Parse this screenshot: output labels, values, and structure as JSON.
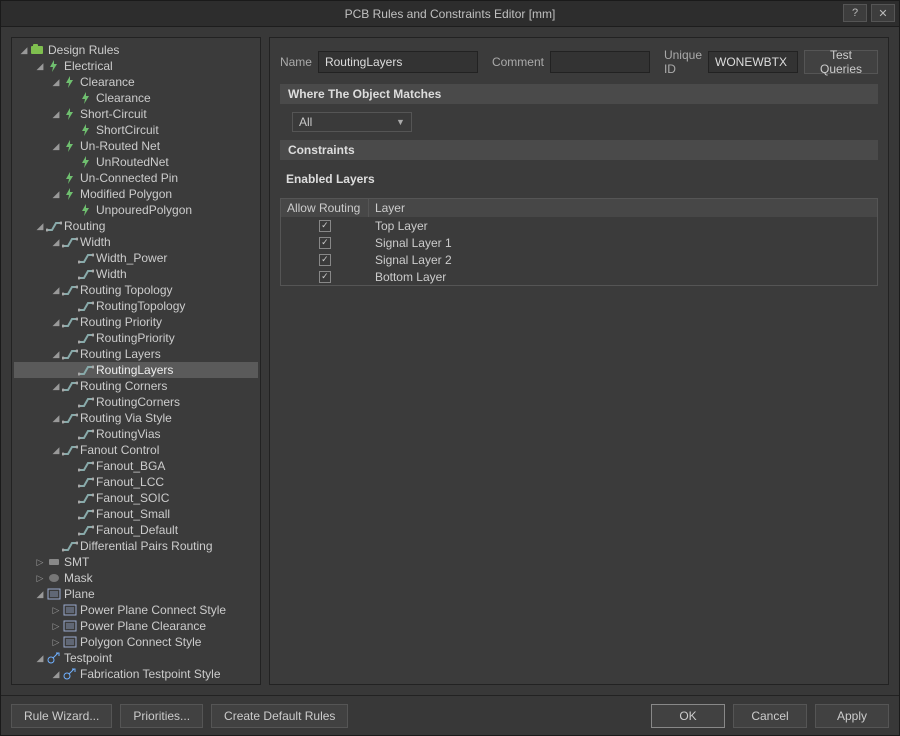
{
  "title": "PCB Rules and Constraints Editor [mm]",
  "titlebar": {
    "help": "?",
    "close": "✕"
  },
  "footer": {
    "ruleWizard": "Rule Wizard...",
    "priorities": "Priorities...",
    "createDefault": "Create Default Rules",
    "ok": "OK",
    "cancel": "Cancel",
    "apply": "Apply"
  },
  "form": {
    "nameLabel": "Name",
    "nameValue": "RoutingLayers",
    "commentLabel": "Comment",
    "commentValue": "",
    "uniqueIdLabel": "Unique ID",
    "uniqueIdValue": "WONEWBTX",
    "testQueries": "Test Queries",
    "whereHeader": "Where The Object Matches",
    "whereValue": "All",
    "constraintsHeader": "Constraints",
    "enabledLayersLabel": "Enabled Layers",
    "colAllow": "Allow Routing",
    "colLayer": "Layer",
    "layers": [
      {
        "name": "Top Layer",
        "allow": true
      },
      {
        "name": "Signal Layer 1",
        "allow": true
      },
      {
        "name": "Signal Layer 2",
        "allow": true
      },
      {
        "name": "Bottom Layer",
        "allow": true
      }
    ]
  },
  "tree": [
    {
      "d": 0,
      "exp": "open",
      "icon": "rules-root",
      "label": "Design Rules"
    },
    {
      "d": 1,
      "exp": "open",
      "icon": "electrical",
      "label": "Electrical"
    },
    {
      "d": 2,
      "exp": "open",
      "icon": "electrical",
      "label": "Clearance"
    },
    {
      "d": 3,
      "exp": "none",
      "icon": "electrical",
      "label": "Clearance"
    },
    {
      "d": 2,
      "exp": "open",
      "icon": "electrical",
      "label": "Short-Circuit"
    },
    {
      "d": 3,
      "exp": "none",
      "icon": "electrical",
      "label": "ShortCircuit"
    },
    {
      "d": 2,
      "exp": "open",
      "icon": "electrical",
      "label": "Un-Routed Net"
    },
    {
      "d": 3,
      "exp": "none",
      "icon": "electrical",
      "label": "UnRoutedNet"
    },
    {
      "d": 2,
      "exp": "none",
      "icon": "electrical",
      "label": "Un-Connected Pin"
    },
    {
      "d": 2,
      "exp": "open",
      "icon": "electrical",
      "label": "Modified Polygon"
    },
    {
      "d": 3,
      "exp": "none",
      "icon": "electrical",
      "label": "UnpouredPolygon"
    },
    {
      "d": 1,
      "exp": "open",
      "icon": "routing",
      "label": "Routing"
    },
    {
      "d": 2,
      "exp": "open",
      "icon": "routing",
      "label": "Width"
    },
    {
      "d": 3,
      "exp": "none",
      "icon": "routing",
      "label": "Width_Power"
    },
    {
      "d": 3,
      "exp": "none",
      "icon": "routing",
      "label": "Width"
    },
    {
      "d": 2,
      "exp": "open",
      "icon": "routing",
      "label": "Routing Topology"
    },
    {
      "d": 3,
      "exp": "none",
      "icon": "routing",
      "label": "RoutingTopology"
    },
    {
      "d": 2,
      "exp": "open",
      "icon": "routing",
      "label": "Routing Priority"
    },
    {
      "d": 3,
      "exp": "none",
      "icon": "routing",
      "label": "RoutingPriority"
    },
    {
      "d": 2,
      "exp": "open",
      "icon": "routing",
      "label": "Routing Layers"
    },
    {
      "d": 3,
      "exp": "none",
      "icon": "routing",
      "label": "RoutingLayers",
      "sel": true
    },
    {
      "d": 2,
      "exp": "open",
      "icon": "routing",
      "label": "Routing Corners"
    },
    {
      "d": 3,
      "exp": "none",
      "icon": "routing",
      "label": "RoutingCorners"
    },
    {
      "d": 2,
      "exp": "open",
      "icon": "routing",
      "label": "Routing Via Style"
    },
    {
      "d": 3,
      "exp": "none",
      "icon": "routing",
      "label": "RoutingVias"
    },
    {
      "d": 2,
      "exp": "open",
      "icon": "routing",
      "label": "Fanout Control"
    },
    {
      "d": 3,
      "exp": "none",
      "icon": "routing",
      "label": "Fanout_BGA"
    },
    {
      "d": 3,
      "exp": "none",
      "icon": "routing",
      "label": "Fanout_LCC"
    },
    {
      "d": 3,
      "exp": "none",
      "icon": "routing",
      "label": "Fanout_SOIC"
    },
    {
      "d": 3,
      "exp": "none",
      "icon": "routing",
      "label": "Fanout_Small"
    },
    {
      "d": 3,
      "exp": "none",
      "icon": "routing",
      "label": "Fanout_Default"
    },
    {
      "d": 2,
      "exp": "none",
      "icon": "routing",
      "label": "Differential Pairs Routing"
    },
    {
      "d": 1,
      "exp": "closed",
      "icon": "smt",
      "label": "SMT"
    },
    {
      "d": 1,
      "exp": "closed",
      "icon": "mask",
      "label": "Mask"
    },
    {
      "d": 1,
      "exp": "open",
      "icon": "plane",
      "label": "Plane"
    },
    {
      "d": 2,
      "exp": "closed",
      "icon": "plane",
      "label": "Power Plane Connect Style"
    },
    {
      "d": 2,
      "exp": "closed",
      "icon": "plane",
      "label": "Power Plane Clearance"
    },
    {
      "d": 2,
      "exp": "closed",
      "icon": "plane",
      "label": "Polygon Connect Style"
    },
    {
      "d": 1,
      "exp": "open",
      "icon": "testpoint",
      "label": "Testpoint"
    },
    {
      "d": 2,
      "exp": "open",
      "icon": "testpoint",
      "label": "Fabrication Testpoint Style"
    }
  ]
}
